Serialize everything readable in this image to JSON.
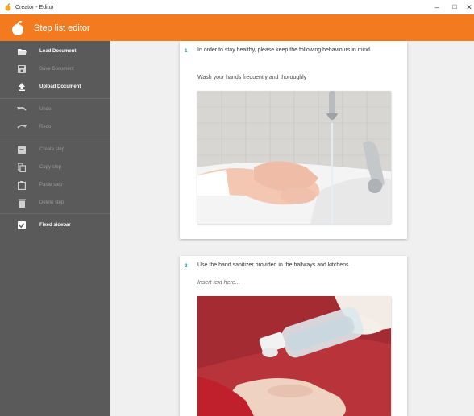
{
  "window": {
    "title": "Creator - Editor",
    "minimize": "–",
    "maximize": "☐",
    "close": "✕"
  },
  "header": {
    "title": "Step list editor"
  },
  "sidebar": {
    "items": [
      {
        "label": "Load Document",
        "icon": "folder-open-icon",
        "state": "active"
      },
      {
        "label": "Save Document",
        "icon": "save-icon",
        "state": "dim"
      },
      {
        "label": "Upload Document",
        "icon": "upload-icon",
        "state": "active"
      },
      {
        "label": "Undo",
        "icon": "undo-icon",
        "state": "dim"
      },
      {
        "label": "Redo",
        "icon": "redo-icon",
        "state": "dim"
      },
      {
        "label": "Create step",
        "icon": "add-box-icon",
        "state": "dim"
      },
      {
        "label": "Copy step",
        "icon": "copy-icon",
        "state": "dim"
      },
      {
        "label": "Paste step",
        "icon": "clipboard-icon",
        "state": "dim"
      },
      {
        "label": "Delete step",
        "icon": "trash-icon",
        "state": "dim"
      },
      {
        "label": "Fixed sidebar",
        "icon": "checkbox-checked-icon",
        "state": "active"
      }
    ]
  },
  "steps": [
    {
      "number": "1",
      "text": "In order to stay healthy, please keep the following behaviours in mind.",
      "subtext": "Wash your hands frequently and thoroughly"
    },
    {
      "number": "2",
      "text": "Use the hand sanitizer provided in the hallways and kitchens",
      "placeholder": "Insert text here..."
    }
  ],
  "colors": {
    "accent": "#f47a20",
    "sidebar": "#5a5a5a",
    "step_number": "#2196c4"
  }
}
